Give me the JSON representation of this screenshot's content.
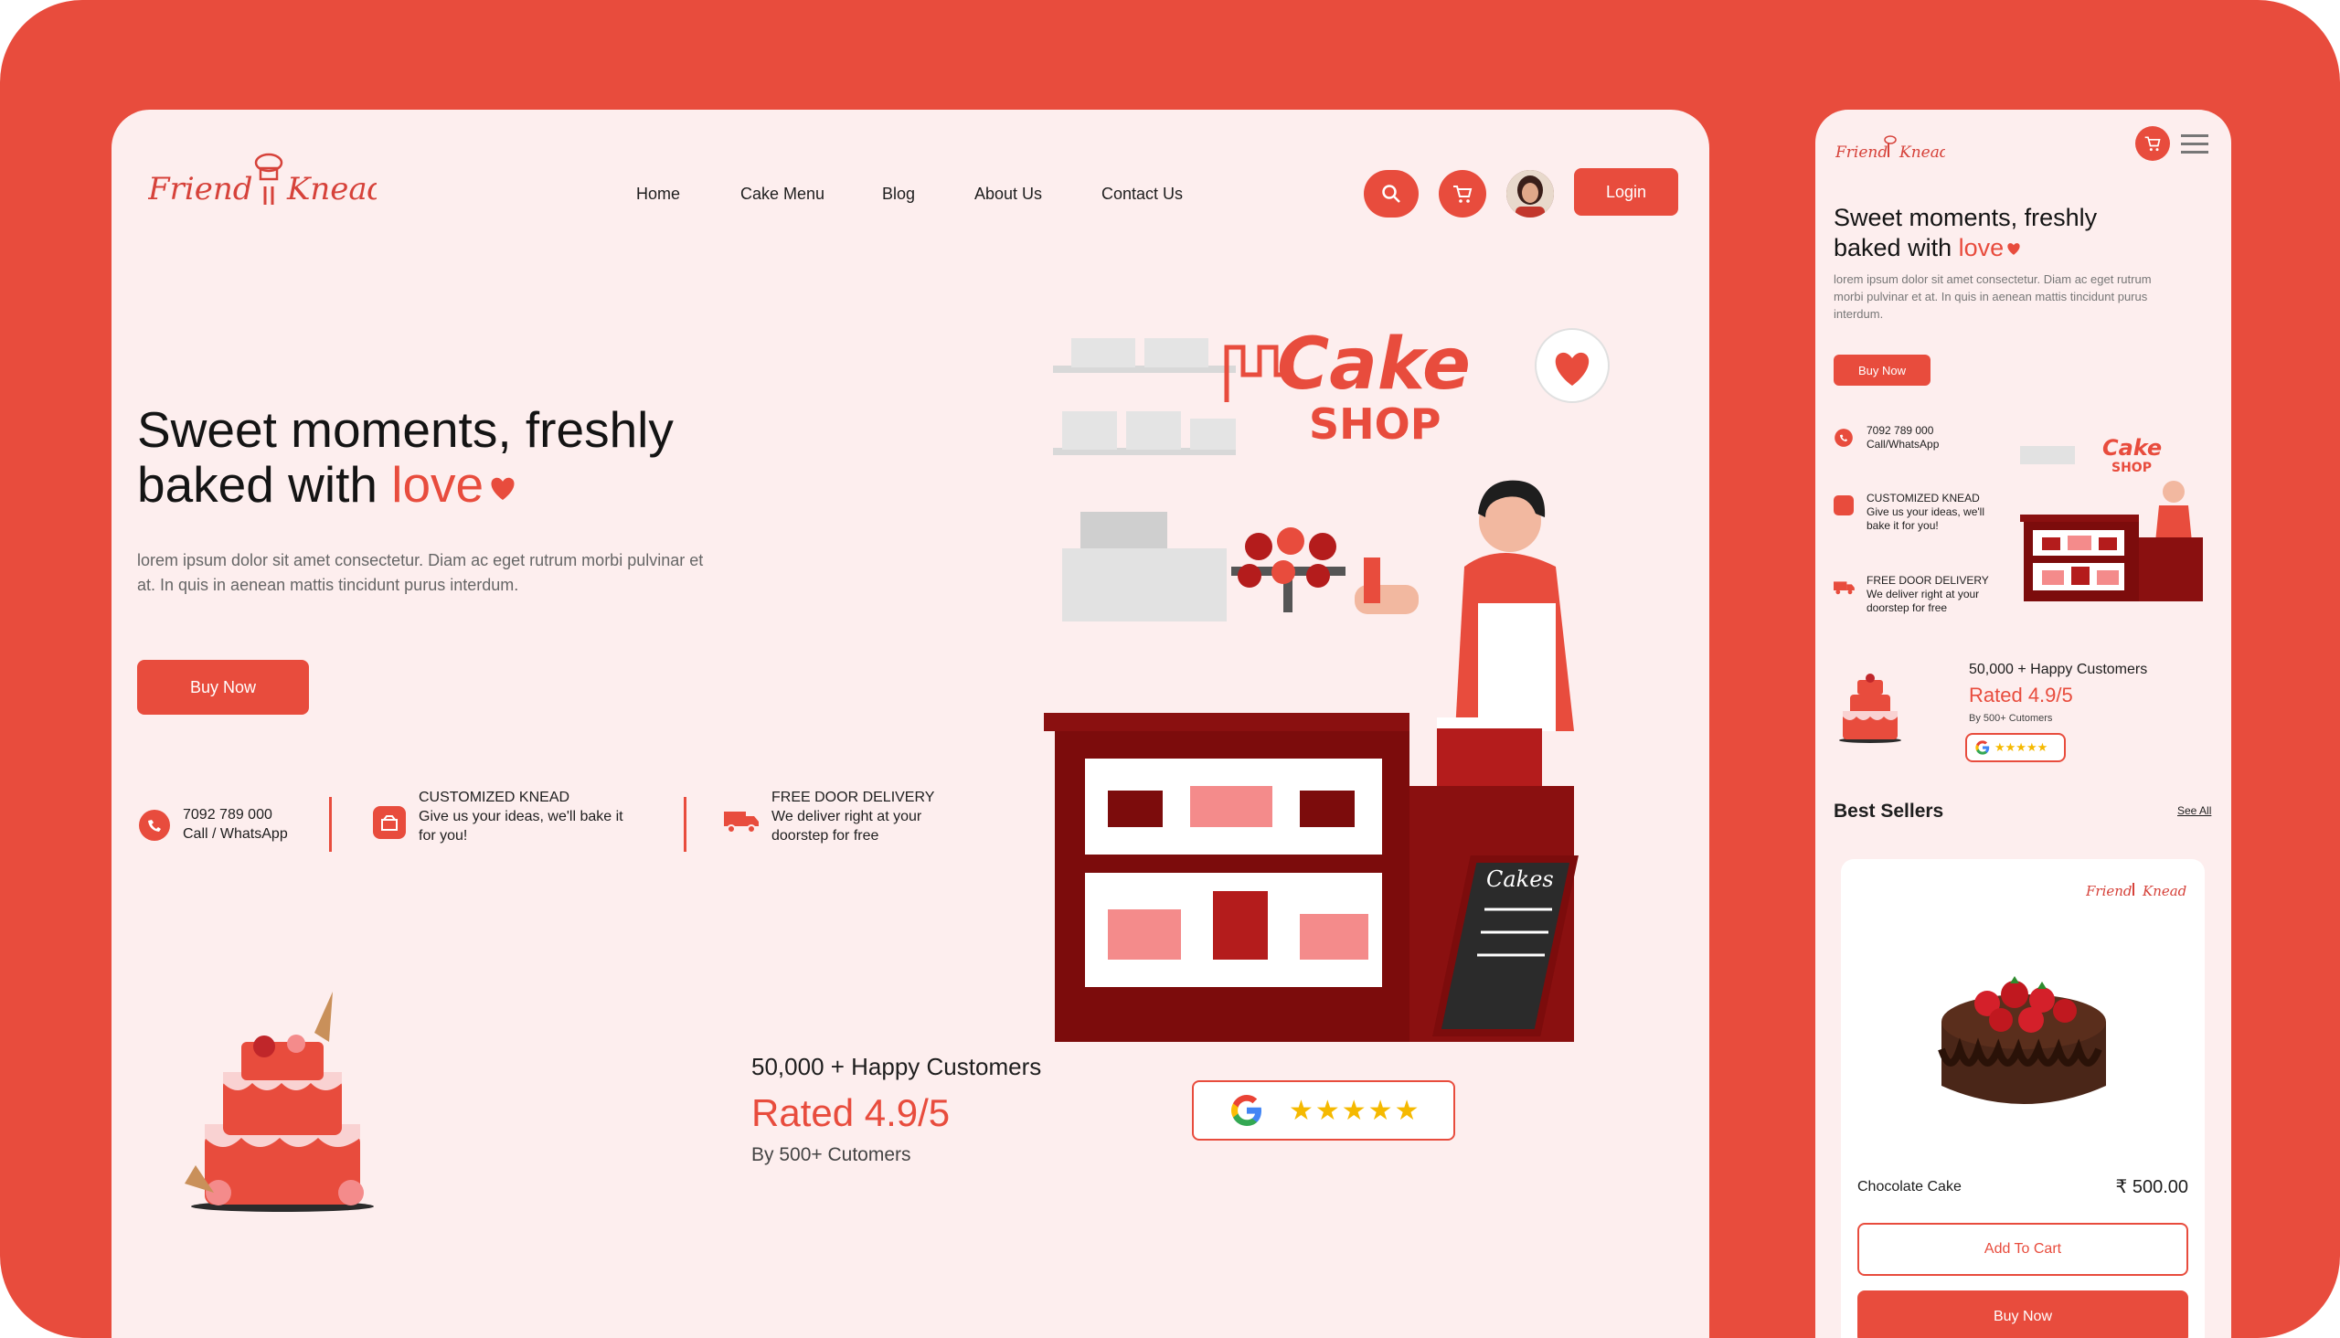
{
  "brand": {
    "name": "Friend n Knead"
  },
  "nav": [
    "Home",
    "Cake Menu",
    "Blog",
    "About Us",
    "Contact Us"
  ],
  "header": {
    "login_label": "Login"
  },
  "hero": {
    "title_line1": "Sweet moments, freshly",
    "title_line2_prefix": "baked with ",
    "title_highlight": "love",
    "paragraph": "lorem ipsum dolor sit amet consectetur. Diam ac eget rutrum morbi pulvinar et at. In quis in aenean mattis tincidunt purus interdum.",
    "buy_label": "Buy Now"
  },
  "features": [
    {
      "title": "7092 789 000",
      "sub": "Call / WhatsApp"
    },
    {
      "title": "CUSTOMIZED KNEAD",
      "sub": "Give us your ideas, we'll bake it for you!"
    },
    {
      "title": "FREE DOOR DELIVERY",
      "sub": "We deliver right at your doorstep for free"
    }
  ],
  "illustration": {
    "sign_word1": "Cake",
    "sign_word2": "SHOP",
    "board_text": "Cakes"
  },
  "rating": {
    "customers": "50,000 + Happy Customers",
    "rated": "Rated 4.9/5",
    "by": "By 500+ Cutomers",
    "stars": "★★★★★",
    "stars_value": 5
  },
  "mobile": {
    "title_line1": "Sweet moments, freshly",
    "title_line2_prefix": "baked with ",
    "title_highlight": "love",
    "paragraph": "lorem ipsum dolor sit amet consectetur. Diam ac eget rutrum morbi pulvinar et at. In quis in aenean mattis tincidunt purus interdum.",
    "buy_label": "Buy Now",
    "features": [
      {
        "title": "7092 789 000",
        "sub": "Call/WhatsApp"
      },
      {
        "title": "CUSTOMIZED KNEAD",
        "sub": "Give us your ideas, we'll bake it for you!"
      },
      {
        "title": "FREE DOOR DELIVERY",
        "sub": "We deliver right at your doorstep for free"
      }
    ],
    "customers": "50,000 + Happy Customers",
    "rated": "Rated 4.9/5",
    "by": "By 500+ Cutomers",
    "best_sellers": "Best Sellers",
    "see_all": "See All",
    "product": {
      "name": "Chocolate Cake",
      "price": "₹ 500.00",
      "add_label": "Add To Cart",
      "buy_label": "Buy Now"
    }
  },
  "colors": {
    "accent": "#e84c3d",
    "maroon": "#7c0c0c",
    "page_bg": "#fdeeee",
    "star": "#f5b900"
  }
}
